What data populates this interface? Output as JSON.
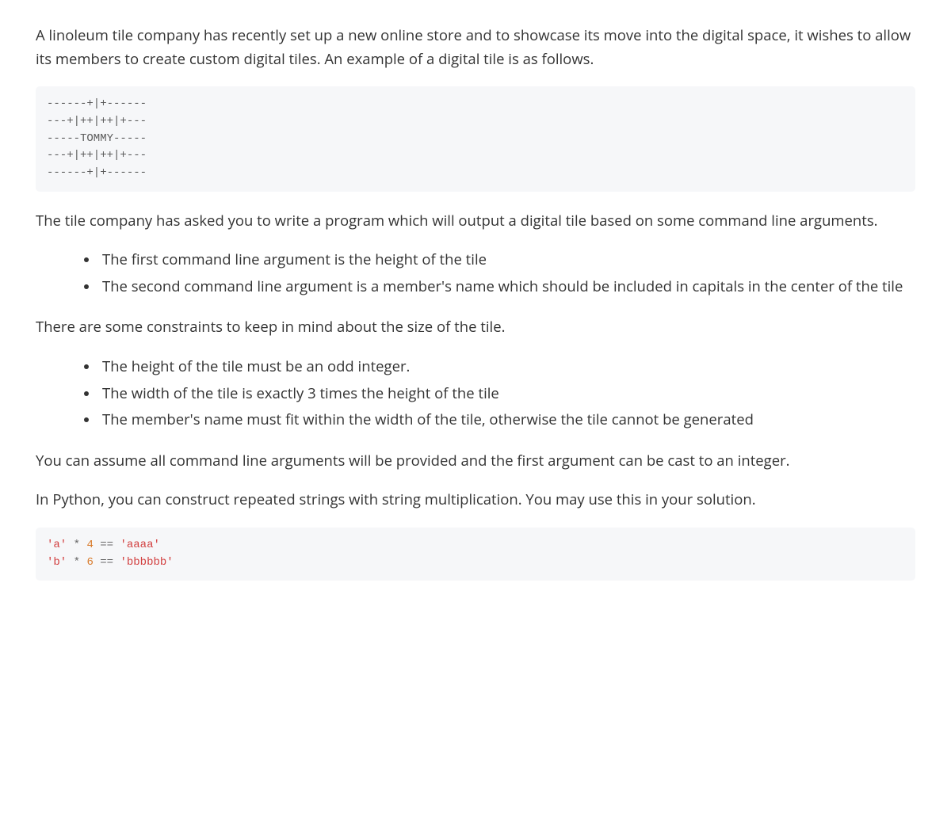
{
  "intro": "A linoleum tile company has recently set up a new online store and to showcase its move into the digital space, it wishes to allow its members to create custom digital tiles. An example of a digital tile is as follows.",
  "tile_example": "------+|+------\n---+|++|++|+---\n-----TOMMY-----\n---+|++|++|+---\n------+|+------",
  "after_example": "The tile company has asked you to write a program which will output a digital tile based on some command line arguments.",
  "args": [
    "The first command line argument is the height of the tile",
    "The second command line argument is a member's name which should be included in capitals in the center of the tile"
  ],
  "constraints_intro": "There are some constraints to keep in mind about the size of the tile.",
  "constraints": [
    "The height of the tile must be an odd integer.",
    "The width of the tile is exactly 3 times the height of the tile",
    "The member's name must fit within the width of the tile, otherwise the tile cannot be generated"
  ],
  "assume": "You can assume all command line arguments will be provided and the first argument can be cast to an integer.",
  "string_mult": "In Python, you can construct repeated strings with string multiplication. You may use this in your solution.",
  "code_example": {
    "line1": {
      "s1": "'a'",
      "op1": "*",
      "n1": "4",
      "op2": "==",
      "s2": "'aaaa'"
    },
    "line2": {
      "s1": "'b'",
      "op1": "*",
      "n1": "6",
      "op2": "==",
      "s2": "'bbbbbb'"
    }
  }
}
